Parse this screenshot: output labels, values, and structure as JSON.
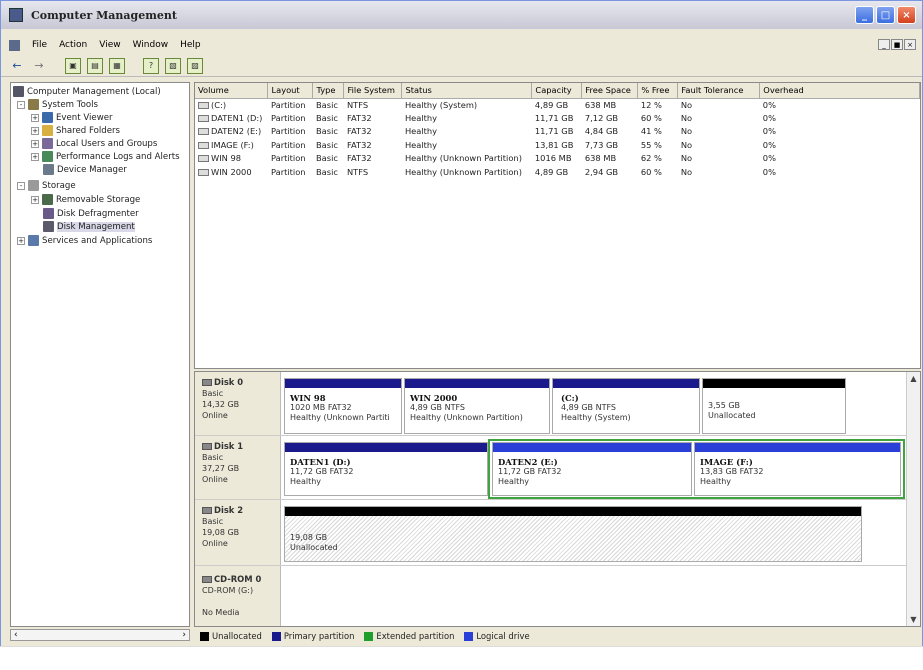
{
  "window": {
    "title": "Computer Management",
    "controls": [
      "_",
      "□",
      "×"
    ]
  },
  "menu": {
    "items": [
      "File",
      "Action",
      "View",
      "Window",
      "Help"
    ],
    "mdi_controls": [
      "_",
      "■",
      "×"
    ]
  },
  "toolbar": {
    "back_icon": "back-arrow",
    "forward_icon": "forward-arrow",
    "tools": [
      "up-folder-icon",
      "show-hide-tree-icon",
      "properties-icon",
      "help-icon",
      "console-icon",
      "settings-icon"
    ]
  },
  "tree": {
    "items": [
      {
        "label": "Computer Management (Local)",
        "indent": 0,
        "expander": "",
        "icon": "computer-icon"
      },
      {
        "label": "System Tools",
        "indent": 1,
        "expander": "-",
        "icon": "tools-icon"
      },
      {
        "label": "Event Viewer",
        "indent": 2,
        "expander": "+",
        "icon": "event-viewer-icon"
      },
      {
        "label": "Shared Folders",
        "indent": 2,
        "expander": "+",
        "icon": "shared-folders-icon"
      },
      {
        "label": "Local Users and Groups",
        "indent": 2,
        "expander": "+",
        "icon": "users-icon"
      },
      {
        "label": "Performance Logs and Alerts",
        "indent": 2,
        "expander": "+",
        "icon": "performance-icon"
      },
      {
        "label": "Device Manager",
        "indent": 2,
        "expander": "",
        "icon": "device-manager-icon"
      },
      {
        "label": "Storage",
        "indent": 1,
        "expander": "-",
        "icon": "storage-icon"
      },
      {
        "label": "Removable Storage",
        "indent": 2,
        "expander": "+",
        "icon": "removable-storage-icon"
      },
      {
        "label": "Disk Defragmenter",
        "indent": 2,
        "expander": "",
        "icon": "defragmenter-icon"
      },
      {
        "label": "Disk Management",
        "indent": 2,
        "expander": "",
        "icon": "disk-management-icon",
        "selected": true
      },
      {
        "label": "Services and Applications",
        "indent": 1,
        "expander": "+",
        "icon": "services-icon"
      }
    ]
  },
  "volumes": {
    "headers": [
      "Volume",
      "Layout",
      "Type",
      "File System",
      "Status",
      "Capacity",
      "Free Space",
      "% Free",
      "Fault Tolerance",
      "Overhead"
    ],
    "rows": [
      [
        "(C:)",
        "Partition",
        "Basic",
        "NTFS",
        "Healthy (System)",
        "4,89 GB",
        "638 MB",
        "12 %",
        "No",
        "0%"
      ],
      [
        "DATEN1 (D:)",
        "Partition",
        "Basic",
        "FAT32",
        "Healthy",
        "11,71 GB",
        "7,12 GB",
        "60 %",
        "No",
        "0%"
      ],
      [
        "DATEN2 (E:)",
        "Partition",
        "Basic",
        "FAT32",
        "Healthy",
        "11,71 GB",
        "4,84 GB",
        "41 %",
        "No",
        "0%"
      ],
      [
        "IMAGE (F:)",
        "Partition",
        "Basic",
        "FAT32",
        "Healthy",
        "13,81 GB",
        "7,73 GB",
        "55 %",
        "No",
        "0%"
      ],
      [
        "WIN 98",
        "Partition",
        "Basic",
        "FAT32",
        "Healthy (Unknown Partition)",
        "1016 MB",
        "638 MB",
        "62 %",
        "No",
        "0%"
      ],
      [
        "WIN 2000",
        "Partition",
        "Basic",
        "NTFS",
        "Healthy (Unknown Partition)",
        "4,89 GB",
        "2,94 GB",
        "60 %",
        "No",
        "0%"
      ]
    ]
  },
  "disks": [
    {
      "name": "Disk 0",
      "type": "Basic",
      "size": "14,32 GB",
      "state": "Online",
      "partitions": [
        {
          "name": "WIN 98",
          "line1": "1020 MB FAT32",
          "line2": "Healthy (Unknown Partiti",
          "kind": "primary"
        },
        {
          "name": "WIN 2000",
          "line1": "4,89 GB NTFS",
          "line2": "Healthy (Unknown Partition)",
          "kind": "primary"
        },
        {
          "name": "(C:)",
          "line1": "4,89 GB NTFS",
          "line2": "Healthy (System)",
          "kind": "primary"
        },
        {
          "name": "",
          "line1": "3,55 GB",
          "line2": "Unallocated",
          "kind": "unallocated"
        }
      ]
    },
    {
      "name": "Disk 1",
      "type": "Basic",
      "size": "37,27 GB",
      "state": "Online",
      "partitions": [
        {
          "name": "DATEN1 (D:)",
          "line1": "11,72 GB FAT32",
          "line2": "Healthy",
          "kind": "primary"
        },
        {
          "name": "DATEN2 (E:)",
          "line1": "11,72 GB FAT32",
          "line2": "Healthy",
          "kind": "logical"
        },
        {
          "name": "IMAGE (F:)",
          "line1": "13,83 GB FAT32",
          "line2": "Healthy",
          "kind": "logical"
        }
      ]
    },
    {
      "name": "Disk 2",
      "type": "Basic",
      "size": "19,08 GB",
      "state": "Online",
      "partitions": [
        {
          "name": "",
          "line1": "19,08 GB",
          "line2": "Unallocated",
          "kind": "unallocated"
        }
      ]
    },
    {
      "name": "CD-ROM 0",
      "type": "CD-ROM (G:)",
      "size": "",
      "state": "No Media",
      "partitions": []
    }
  ],
  "legend": [
    {
      "label": "Unallocated",
      "color": "#000000"
    },
    {
      "label": "Primary partition",
      "color": "#1a1a8c"
    },
    {
      "label": "Extended partition",
      "color": "#1e9e2a"
    },
    {
      "label": "Logical drive",
      "color": "#2a3fd8"
    }
  ],
  "colors": {
    "primary_stripe": "#1a1a8c",
    "logical_stripe": "#2a3fd8",
    "unallocated_stripe": "#000000",
    "extended_border": "#3fa33f"
  }
}
